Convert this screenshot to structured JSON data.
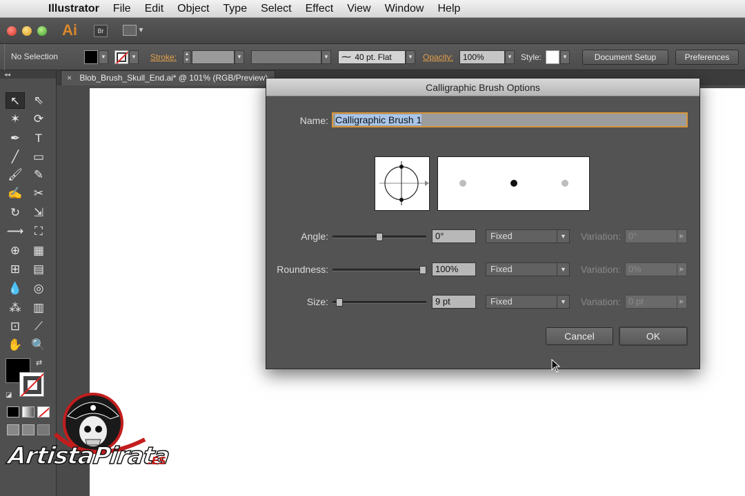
{
  "menubar": {
    "app_name": "Illustrator",
    "items": [
      "File",
      "Edit",
      "Object",
      "Type",
      "Select",
      "Effect",
      "View",
      "Window",
      "Help"
    ]
  },
  "appbar": {
    "logo": "Ai",
    "bridge": "Br"
  },
  "control_bar": {
    "selection_status": "No Selection",
    "stroke_label": "Stroke:",
    "brush_profile": "40 pt. Flat",
    "opacity_label": "Opacity:",
    "opacity_value": "100%",
    "style_label": "Style:",
    "document_setup": "Document Setup",
    "preferences": "Preferences"
  },
  "document_tab": {
    "close": "×",
    "title": "Blob_Brush_Skull_End.ai* @ 101% (RGB/Preview)"
  },
  "dialog": {
    "title": "Calligraphic Brush Options",
    "name_label": "Name:",
    "name_value": "Calligraphic Brush 1",
    "rows": [
      {
        "label": "Angle:",
        "value": "0°",
        "mode": "Fixed",
        "variation_label": "Variation:",
        "variation_value": "0°",
        "slider_fraction": 0.5
      },
      {
        "label": "Roundness:",
        "value": "100%",
        "mode": "Fixed",
        "variation_label": "Variation:",
        "variation_value": "0%",
        "slider_fraction": 1.0
      },
      {
        "label": "Size:",
        "value": "9 pt",
        "mode": "Fixed",
        "variation_label": "Variation:",
        "variation_value": "0 pt",
        "slider_fraction": 0.05
      }
    ],
    "cancel": "Cancel",
    "ok": "OK"
  },
  "watermark": {
    "brand": "ArtistaPirata",
    "tld": ".ES"
  },
  "colors": {
    "accent": "#d9953a",
    "link": "#e5a04a",
    "ai_logo": "#d9882a"
  }
}
